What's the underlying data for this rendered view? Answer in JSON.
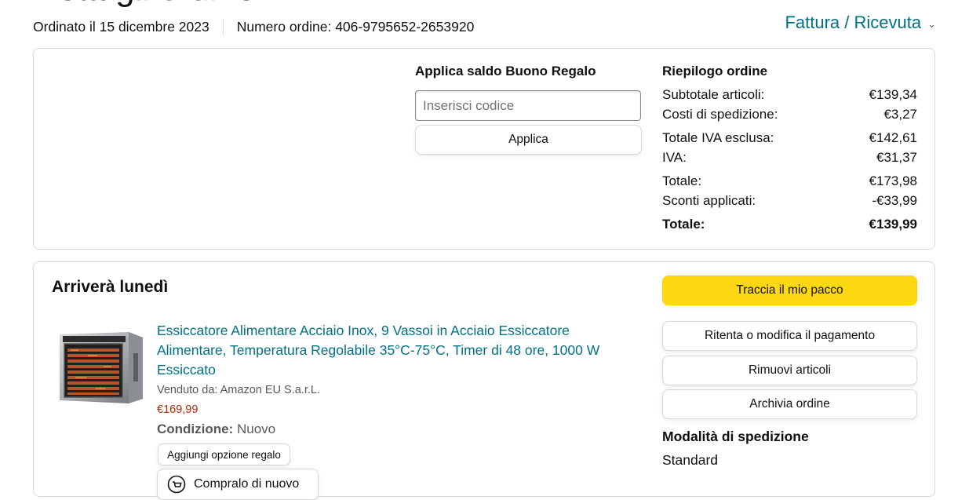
{
  "page_heading": "Dettagli ordine",
  "order": {
    "date": "Ordinato il 15 dicembre 2023",
    "number": "Numero ordine: 406-9795652-2653920",
    "invoice_link": "Fattura / Ricevuta"
  },
  "gift_card": {
    "title": "Applica saldo Buono Regalo",
    "placeholder": "Inserisci codice",
    "apply_label": "Applica"
  },
  "summary": {
    "title": "Riepilogo ordine",
    "rows": [
      {
        "label": "Subtotale articoli:",
        "value": "€139,34"
      },
      {
        "label": "Costi di spedizione:",
        "value": "€3,27"
      },
      {
        "label": "Totale IVA esclusa:",
        "value": "€142,61"
      },
      {
        "label": "IVA:",
        "value": "€31,37"
      },
      {
        "label": "Totale:",
        "value": "€173,98"
      },
      {
        "label": "Sconti applicati:",
        "value": "-€33,99"
      },
      {
        "label": "Totale:",
        "value": "€139,99"
      }
    ]
  },
  "shipment": {
    "arrival": "Arriverà lunedì",
    "product": {
      "title": "Essiccatore Alimentare Acciaio Inox, 9 Vassoi in Acciaio Essiccatore Alimentare, Temperatura Regolabile 35°C-75°C, Timer di 48 ore, 1000 W Essiccato",
      "seller": "Venduto da: Amazon EU S.a.r.L.",
      "price": "€169,99",
      "condition_label": "Condizione:",
      "condition_value": "Nuovo",
      "gift_option": "Aggiungi opzione regalo",
      "buy_again": "Compralo di nuovo"
    },
    "actions": {
      "track": "Traccia il mio pacco",
      "retry_payment": "Ritenta o modifica il pagamento",
      "remove_items": "Rimuovi articoli",
      "archive": "Archivia ordine"
    },
    "shipping_method_title": "Modalità di spedizione",
    "shipping_method": "Standard"
  },
  "colors": {
    "link": "#007185",
    "price": "#b12704",
    "primary_button": "#ffd814",
    "border": "#d5d9d9"
  }
}
